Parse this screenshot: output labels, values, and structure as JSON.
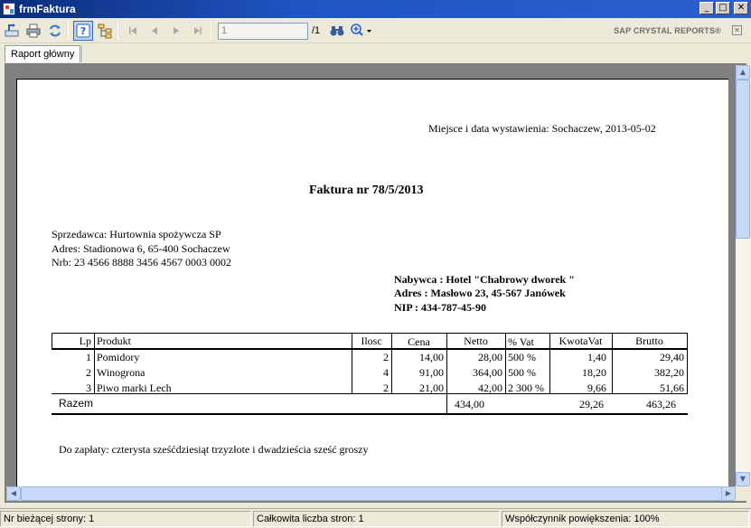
{
  "window": {
    "title": "frmFaktura",
    "min_label": "_",
    "max_label": "□",
    "close_label": "✕"
  },
  "toolbar": {
    "page_input_value": "1",
    "page_total": "/1",
    "brand": "SAP CRYSTAL REPORTS®",
    "brand_close": "✕"
  },
  "tabs": [
    {
      "label": "Raport główny"
    }
  ],
  "report": {
    "place_date": "Miejsce i data wystawienia: Sochaczew, 2013-05-02",
    "invoice_title": "Faktura nr 78/5/2013",
    "seller": {
      "line1": "Sprzedawca: Hurtownia spożywcza SP",
      "line2": "Adres: Stadionowa 6, 65-400  Sochaczew",
      "line3": "Nrb: 23 4566 8888 3456 4567 0003 0002"
    },
    "buyer": {
      "line1": "Nabywca  : Hotel  \"Chabrowy dworek   \"",
      "line2": "Adres : Masłowo  23, 45-567 Janówek",
      "line3": "NIP : 434-787-45-90"
    },
    "table": {
      "headers": [
        "Lp",
        "Produkt",
        "Ilosc",
        "Cena",
        "Netto",
        "% Vat",
        "KwotaVat",
        "Brutto"
      ],
      "rows": [
        [
          "1",
          "Pomidory",
          "2",
          "14,00",
          "28,00",
          "500 %",
          "1,40",
          "29,40"
        ],
        [
          "2",
          "Winogrona",
          "4",
          "91,00",
          "364,00",
          "500 %",
          "18,20",
          "382,20"
        ],
        [
          "3",
          "Piwo marki Lech",
          "2",
          "21,00",
          "42,00",
          "2 300 %",
          "9,66",
          "51,66"
        ]
      ],
      "total_label": "Razem",
      "total_netto": "434,00",
      "total_vat": "29,26",
      "total_brutto": "463,26"
    },
    "amount_words": "Do zapłaty: czterysta sześćdziesiąt trzyzłote i dwadzieścia sześć groszy"
  },
  "status": {
    "current_page": "Nr bieżącej strony: 1",
    "total_pages": "Całkowita liczba stron: 1",
    "zoom": "Współczynnik powiększenia: 100%"
  }
}
